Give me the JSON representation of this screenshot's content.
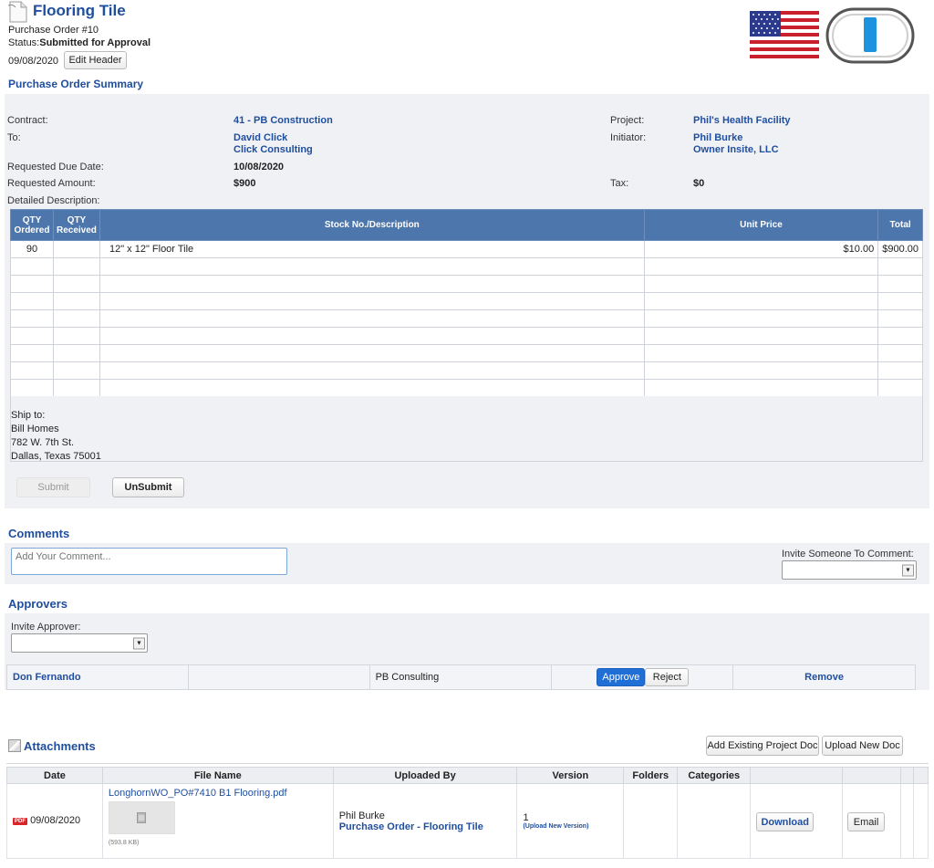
{
  "header": {
    "title": "Flooring Tile",
    "po_number": "Purchase Order #10",
    "status_label": "Status:",
    "status_value": "Submitted for Approval",
    "date": "09/08/2020",
    "edit_header_label": "Edit Header"
  },
  "summary": {
    "title": "Purchase Order Summary",
    "contract_label": "Contract:",
    "contract_value": "41 - PB Construction",
    "to_label": "To:",
    "to_name": "David Click",
    "to_company": "Click Consulting",
    "due_date_label": "Requested Due Date:",
    "due_date_value": "10/08/2020",
    "amount_label": "Requested Amount:",
    "amount_value": "$900",
    "project_label": "Project:",
    "project_value": "Phil's Health Facility",
    "initiator_label": "Initiator:",
    "initiator_name": "Phil Burke",
    "initiator_company": "Owner Insite, LLC",
    "tax_label": "Tax:",
    "tax_value": "$0",
    "description_label": "Detailed Description:"
  },
  "items_table": {
    "headers": {
      "qty_ordered_1": "QTY",
      "qty_ordered_2": "Ordered",
      "qty_received_1": "QTY",
      "qty_received_2": "Received",
      "description": "Stock No./Description",
      "unit_price": "Unit Price",
      "total": "Total"
    },
    "rows": [
      {
        "qty_ordered": "90",
        "qty_received": "",
        "description": "12\" x 12\" Floor Tile",
        "unit_price": "$10.00",
        "total": "$900.00"
      }
    ]
  },
  "ship_to": {
    "label": "Ship to:",
    "line1": "Bill Homes",
    "line2": "782 W. 7th St.",
    "line3": "Dallas, Texas 75001"
  },
  "actions": {
    "submit_label": "Submit",
    "unsubmit_label": "UnSubmit"
  },
  "comments": {
    "title": "Comments",
    "placeholder": "Add Your Comment...",
    "invite_label": "Invite Someone To Comment:"
  },
  "approvers": {
    "title": "Approvers",
    "invite_label": "Invite Approver:",
    "rows": [
      {
        "name": "Don Fernando",
        "company": "PB Consulting",
        "approve_label": "Approve",
        "reject_label": "Reject",
        "remove_label": "Remove"
      }
    ]
  },
  "attachments": {
    "title": "Attachments",
    "add_existing_label": "Add Existing Project Doc",
    "upload_new_label": "Upload New Doc",
    "headers": {
      "date": "Date",
      "file_name": "File Name",
      "uploaded_by": "Uploaded By",
      "version": "Version",
      "folders": "Folders",
      "categories": "Categories"
    },
    "rows": [
      {
        "file_badge": "PDF",
        "date": "09/08/2020",
        "file_name": "LonghornWO_PO#7410 B1 Flooring.pdf",
        "file_size": "(593.8 KB)",
        "uploaded_by": "Phil Burke",
        "uploaded_link": "Purchase Order - Flooring Tile",
        "version": "1",
        "upload_version_label": "(Upload New Version)",
        "download_label": "Download",
        "email_label": "Email"
      }
    ]
  },
  "icons": {
    "document": "document-icon",
    "flag": "us-flag-icon",
    "logo": "app-logo-icon",
    "attachment": "attachment-icon",
    "pdf": "pdf-file-icon"
  },
  "colors": {
    "accent": "#1f4e9e",
    "table_header": "#4d76ac",
    "panel": "#f0f1f5",
    "primary_button": "#1f6fd6"
  }
}
